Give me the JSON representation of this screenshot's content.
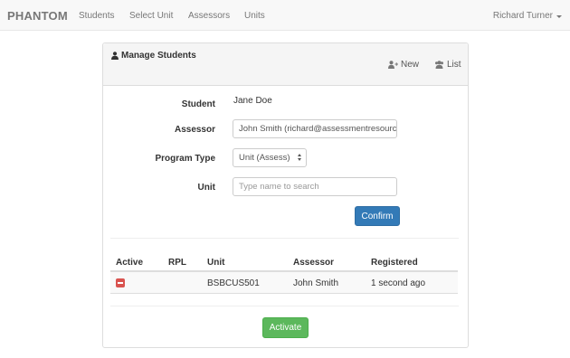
{
  "navbar": {
    "brand": "PHANTOM",
    "links": [
      "Students",
      "Select Unit",
      "Assessors",
      "Units"
    ],
    "user": "Richard Turner"
  },
  "panel": {
    "title": "Manage Students",
    "new_label": "New",
    "list_label": "List"
  },
  "form": {
    "student_label": "Student",
    "student_value": "Jane Doe",
    "assessor_label": "Assessor",
    "assessor_value": "John Smith (richard@assessmentresourc",
    "program_type_label": "Program Type",
    "program_type_value": "Unit (Assess)",
    "unit_label": "Unit",
    "unit_placeholder": "Type name to search",
    "confirm_label": "Confirm"
  },
  "table": {
    "headers": [
      "Active",
      "RPL",
      "Unit",
      "Assessor",
      "Registered"
    ],
    "rows": [
      {
        "unit": "BSBCUS501",
        "assessor": "John Smith",
        "registered": "1 second ago"
      }
    ]
  },
  "activate_label": "Activate",
  "colors": {
    "primary": "#337ab7",
    "success": "#5cb85c",
    "danger": "#d9534f"
  }
}
